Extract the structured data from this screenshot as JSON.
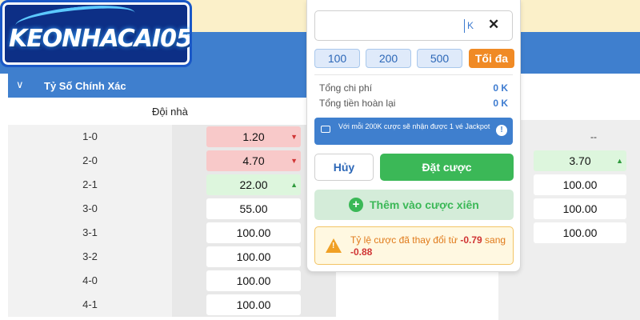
{
  "logo": {
    "text": "KEONHACAI05"
  },
  "section": {
    "title": "Tỷ Số Chính Xác",
    "column_home": "Đội nhà"
  },
  "home_rows": [
    {
      "score": "1-0",
      "odd": "1.20",
      "trend": "down"
    },
    {
      "score": "2-0",
      "odd": "4.70",
      "trend": "down"
    },
    {
      "score": "2-1",
      "odd": "22.00",
      "trend": "up"
    },
    {
      "score": "3-0",
      "odd": "55.00",
      "trend": "none"
    },
    {
      "score": "3-1",
      "odd": "100.00",
      "trend": "none"
    },
    {
      "score": "3-2",
      "odd": "100.00",
      "trend": "none"
    },
    {
      "score": "4-0",
      "odd": "100.00",
      "trend": "none"
    },
    {
      "score": "4-1",
      "odd": "100.00",
      "trend": "none"
    }
  ],
  "away_column": {
    "dash": "--",
    "odds": [
      "3.70",
      "100.00",
      "100.00",
      "100.00"
    ]
  },
  "betslip": {
    "amount_value": "",
    "amount_unit": "K",
    "clear_glyph": "✕",
    "quick_amounts": [
      "100",
      "200",
      "500"
    ],
    "max_label": "Tối đa",
    "total_cost_label": "Tổng chi phí",
    "total_cost_value": "0 K",
    "total_refund_label": "Tổng tiền hoàn lại",
    "total_refund_value": "0 K",
    "jackpot_text": "Với mỗi 200K cược sẽ nhận được 1 vé Jackpot",
    "info_glyph": "!",
    "cancel_label": "Hủy",
    "place_label": "Đặt cược",
    "parlay_label": "Thêm vào cược xiên",
    "plus_glyph": "+",
    "warning_prefix": "Tỷ lệ cược đã thay đổi từ",
    "warning_old": "-0.79",
    "warning_mid": "sang",
    "warning_new": "-0.88"
  },
  "icons": {
    "arrow_down": "▼",
    "arrow_up": "▲",
    "chevron": "∨"
  },
  "colors": {
    "brand_blue": "#3f7fce",
    "accent_orange": "#f08a25",
    "success_green": "#3bb857",
    "odds_down": "#f8c9c9",
    "odds_up": "#ddf6dd"
  }
}
